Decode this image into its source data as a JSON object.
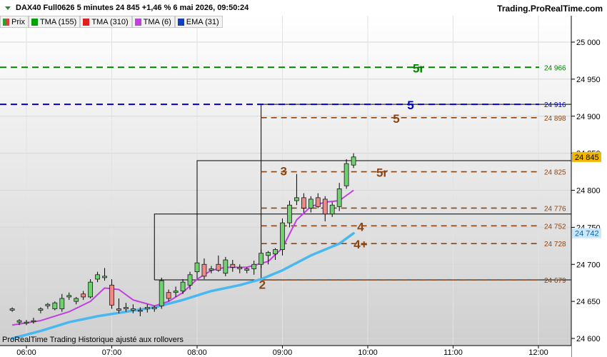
{
  "header": {
    "title": "DAX40 Full0626 5 minutes 24 845 +1,46 % 6 mai 2026, 09:50:24",
    "brand": "Trading.ProRealTime.com"
  },
  "legend": [
    {
      "label": "Prix",
      "color": "#4caf50",
      "icon": "price-icon"
    },
    {
      "label": "TMA (155)",
      "color": "#00a000"
    },
    {
      "label": "TMA (310)",
      "color": "#e02020"
    },
    {
      "label": "TMA (6)",
      "color": "#c040e0"
    },
    {
      "label": "EMA (31)",
      "color": "#1040c0"
    }
  ],
  "footnote": "ProRealTime Trading  Historique ajusté aux rollovers",
  "chart_data": {
    "type": "candlestick",
    "y_ticks": [
      "24 600",
      "24 650",
      "24 700",
      "24 750",
      "24 800",
      "24 850",
      "24 900",
      "24 950",
      "25 000"
    ],
    "ylim": [
      24595,
      25030
    ],
    "x_ticks": [
      "06:00",
      "07:00",
      "08:00",
      "09:00",
      "10:00",
      "11:00",
      "12:00"
    ],
    "price_badges": [
      {
        "value": "24 845",
        "bg": "#f0b800",
        "color": "#000000"
      },
      {
        "value": "24 742",
        "bg": "#c8e8ff",
        "color": "#1060a0"
      }
    ],
    "levels": [
      {
        "value": 24966,
        "label": "24 966",
        "color": "#008000",
        "marker": "5r",
        "start": "all"
      },
      {
        "value": 24916,
        "label": "24 916",
        "color": "#0000c8",
        "marker": "5",
        "start": "all"
      },
      {
        "value": 24898,
        "label": "24 898",
        "color": "#8b4513",
        "marker": "5",
        "start": "08:45"
      },
      {
        "value": 24825,
        "label": "24 825",
        "color": "#8b4513",
        "marker": "5r",
        "start": "08:45"
      },
      {
        "value": 24776,
        "label": "24 776",
        "color": "#8b4513",
        "marker": "",
        "start": "08:45"
      },
      {
        "value": 24752,
        "label": "24 752",
        "color": "#8b4513",
        "marker": "4",
        "start": "08:45"
      },
      {
        "value": 24728,
        "label": "24 728",
        "color": "#8b4513",
        "marker": "4+",
        "start": "08:45"
      },
      {
        "value": 24679,
        "label": "24 679",
        "color": "#8b4513",
        "marker": "",
        "start": "08:45"
      }
    ],
    "plain_markers": [
      {
        "text": "3",
        "time": "09:00",
        "value": 24826,
        "color": "#8b4513"
      },
      {
        "text": "2",
        "time": "08:45",
        "value": 24673,
        "color": "#8b4513"
      }
    ],
    "boxes": [
      {
        "start": "08:45",
        "top": 24916,
        "bottom": 24679
      },
      {
        "start": "08:00",
        "top": 24840,
        "bottom": 24679
      },
      {
        "start": "07:30",
        "top": 24768,
        "bottom": 24679
      }
    ],
    "candles": [
      {
        "t": "05:50",
        "o": 24638,
        "h": 24642,
        "l": 24636,
        "c": 24640
      },
      {
        "t": "05:55",
        "o": 24622,
        "h": 24626,
        "l": 24618,
        "c": 24624
      },
      {
        "t": "06:00",
        "o": 24622,
        "h": 24625,
        "l": 24618,
        "c": 24622
      },
      {
        "t": "06:05",
        "o": 24624,
        "h": 24628,
        "l": 24620,
        "c": 24623
      },
      {
        "t": "06:10",
        "o": 24638,
        "h": 24642,
        "l": 24634,
        "c": 24640
      },
      {
        "t": "06:15",
        "o": 24644,
        "h": 24648,
        "l": 24640,
        "c": 24646
      },
      {
        "t": "06:20",
        "o": 24640,
        "h": 24650,
        "l": 24638,
        "c": 24648
      },
      {
        "t": "06:25",
        "o": 24640,
        "h": 24660,
        "l": 24636,
        "c": 24654
      },
      {
        "t": "06:30",
        "o": 24656,
        "h": 24662,
        "l": 24652,
        "c": 24658
      },
      {
        "t": "06:35",
        "o": 24650,
        "h": 24656,
        "l": 24646,
        "c": 24654
      },
      {
        "t": "06:40",
        "o": 24660,
        "h": 24664,
        "l": 24652,
        "c": 24656
      },
      {
        "t": "06:45",
        "o": 24656,
        "h": 24680,
        "l": 24654,
        "c": 24676
      },
      {
        "t": "06:50",
        "o": 24680,
        "h": 24690,
        "l": 24676,
        "c": 24686
      },
      {
        "t": "06:55",
        "o": 24682,
        "h": 24695,
        "l": 24678,
        "c": 24684
      },
      {
        "t": "07:00",
        "o": 24672,
        "h": 24680,
        "l": 24640,
        "c": 24645
      },
      {
        "t": "07:05",
        "o": 24640,
        "h": 24654,
        "l": 24634,
        "c": 24638
      },
      {
        "t": "07:10",
        "o": 24640,
        "h": 24648,
        "l": 24636,
        "c": 24642
      },
      {
        "t": "07:15",
        "o": 24638,
        "h": 24646,
        "l": 24634,
        "c": 24640
      },
      {
        "t": "07:20",
        "o": 24638,
        "h": 24642,
        "l": 24630,
        "c": 24637
      },
      {
        "t": "07:25",
        "o": 24640,
        "h": 24646,
        "l": 24635,
        "c": 24642
      },
      {
        "t": "07:30",
        "o": 24640,
        "h": 24644,
        "l": 24636,
        "c": 24642
      },
      {
        "t": "07:35",
        "o": 24644,
        "h": 24682,
        "l": 24640,
        "c": 24678
      },
      {
        "t": "07:40",
        "o": 24662,
        "h": 24666,
        "l": 24650,
        "c": 24654
      },
      {
        "t": "07:45",
        "o": 24662,
        "h": 24670,
        "l": 24656,
        "c": 24664
      },
      {
        "t": "07:50",
        "o": 24664,
        "h": 24680,
        "l": 24660,
        "c": 24676
      },
      {
        "t": "07:55",
        "o": 24672,
        "h": 24690,
        "l": 24666,
        "c": 24686
      },
      {
        "t": "08:00",
        "o": 24690,
        "h": 24706,
        "l": 24686,
        "c": 24702
      },
      {
        "t": "08:05",
        "o": 24700,
        "h": 24708,
        "l": 24680,
        "c": 24684
      },
      {
        "t": "08:10",
        "o": 24692,
        "h": 24698,
        "l": 24688,
        "c": 24694
      },
      {
        "t": "08:15",
        "o": 24700,
        "h": 24712,
        "l": 24690,
        "c": 24692
      },
      {
        "t": "08:20",
        "o": 24688,
        "h": 24710,
        "l": 24684,
        "c": 24706
      },
      {
        "t": "08:25",
        "o": 24700,
        "h": 24706,
        "l": 24690,
        "c": 24696
      },
      {
        "t": "08:30",
        "o": 24696,
        "h": 24700,
        "l": 24688,
        "c": 24694
      },
      {
        "t": "08:35",
        "o": 24694,
        "h": 24696,
        "l": 24688,
        "c": 24692
      },
      {
        "t": "08:40",
        "o": 24694,
        "h": 24705,
        "l": 24686,
        "c": 24700
      },
      {
        "t": "08:45",
        "o": 24700,
        "h": 24720,
        "l": 24695,
        "c": 24715
      },
      {
        "t": "08:50",
        "o": 24712,
        "h": 24718,
        "l": 24700,
        "c": 24716
      },
      {
        "t": "08:55",
        "o": 24714,
        "h": 24722,
        "l": 24706,
        "c": 24720
      },
      {
        "t": "09:00",
        "o": 24720,
        "h": 24762,
        "l": 24712,
        "c": 24756
      },
      {
        "t": "09:05",
        "o": 24756,
        "h": 24786,
        "l": 24750,
        "c": 24780
      },
      {
        "t": "09:10",
        "o": 24786,
        "h": 24822,
        "l": 24780,
        "c": 24790
      },
      {
        "t": "09:15",
        "o": 24790,
        "h": 24796,
        "l": 24770,
        "c": 24776
      },
      {
        "t": "09:20",
        "o": 24776,
        "h": 24792,
        "l": 24770,
        "c": 24788
      },
      {
        "t": "09:25",
        "o": 24790,
        "h": 24796,
        "l": 24776,
        "c": 24778
      },
      {
        "t": "09:30",
        "o": 24788,
        "h": 24792,
        "l": 24758,
        "c": 24768
      },
      {
        "t": "09:35",
        "o": 24768,
        "h": 24784,
        "l": 24764,
        "c": 24780
      },
      {
        "t": "09:40",
        "o": 24778,
        "h": 24810,
        "l": 24772,
        "c": 24802
      },
      {
        "t": "09:45",
        "o": 24806,
        "h": 24842,
        "l": 24802,
        "c": 24836
      },
      {
        "t": "09:50",
        "o": 24834,
        "h": 24850,
        "l": 24830,
        "c": 24845
      }
    ],
    "tma6": [
      [
        "05:50",
        24618
      ],
      [
        "06:10",
        24624
      ],
      [
        "06:30",
        24636
      ],
      [
        "06:45",
        24650
      ],
      [
        "06:55",
        24668
      ],
      [
        "07:05",
        24666
      ],
      [
        "07:15",
        24652
      ],
      [
        "07:30",
        24644
      ],
      [
        "07:40",
        24650
      ],
      [
        "07:50",
        24662
      ],
      [
        "08:00",
        24680
      ],
      [
        "08:10",
        24692
      ],
      [
        "08:20",
        24696
      ],
      [
        "08:35",
        24696
      ],
      [
        "08:50",
        24704
      ],
      [
        "09:00",
        24722
      ],
      [
        "09:10",
        24760
      ],
      [
        "09:20",
        24778
      ],
      [
        "09:30",
        24784
      ],
      [
        "09:40",
        24786
      ],
      [
        "09:50",
        24800
      ]
    ],
    "ema31": [
      [
        "05:50",
        24600
      ],
      [
        "06:10",
        24610
      ],
      [
        "06:30",
        24622
      ],
      [
        "06:50",
        24630
      ],
      [
        "07:10",
        24636
      ],
      [
        "07:30",
        24642
      ],
      [
        "07:50",
        24652
      ],
      [
        "08:10",
        24664
      ],
      [
        "08:30",
        24672
      ],
      [
        "08:45",
        24680
      ],
      [
        "09:00",
        24692
      ],
      [
        "09:20",
        24712
      ],
      [
        "09:40",
        24728
      ],
      [
        "09:50",
        24742
      ]
    ]
  }
}
